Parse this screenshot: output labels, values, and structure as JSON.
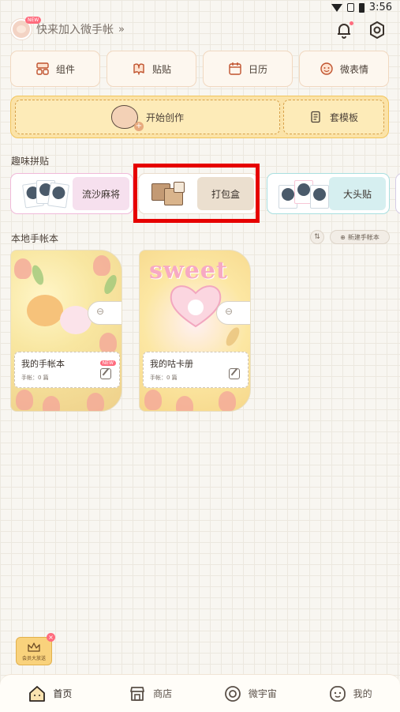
{
  "status_bar": {
    "time": "3:56"
  },
  "header": {
    "join_text": "快来加入微手帐",
    "chevron": "»",
    "new_badge": "NEW"
  },
  "tools": [
    {
      "label": "组件",
      "icon": "widget-icon"
    },
    {
      "label": "贴贴",
      "icon": "sticker-icon"
    },
    {
      "label": "日历",
      "icon": "calendar-icon"
    },
    {
      "label": "微表情",
      "icon": "emoji-icon"
    }
  ],
  "create": {
    "start_label": "开始创作",
    "templates_label": "套模板"
  },
  "fun_stickers": {
    "title": "趣味拼贴",
    "items": [
      {
        "label": "流沙麻将"
      },
      {
        "label": "打包盒"
      },
      {
        "label": "大头贴"
      }
    ]
  },
  "local_books": {
    "title": "本地手帐本",
    "new_button": "新建手帐本",
    "books": [
      {
        "name": "我的手帐本",
        "count": "手帐：0 篇",
        "new_tag": "NEW"
      },
      {
        "name": "我的咕卡册",
        "count": "手帐：0 篇",
        "cover_text": "sweet"
      }
    ]
  },
  "promo": {
    "text": "会员大放送"
  },
  "nav": [
    {
      "label": "首页",
      "icon": "home-icon",
      "active": true
    },
    {
      "label": "商店",
      "icon": "shop-icon",
      "active": false
    },
    {
      "label": "微宇宙",
      "icon": "universe-icon",
      "active": false
    },
    {
      "label": "我的",
      "icon": "profile-icon",
      "active": false
    }
  ],
  "colors": {
    "accent": "#f2c55b",
    "highlight": "#e60000",
    "badge": "#ff6b7d"
  }
}
